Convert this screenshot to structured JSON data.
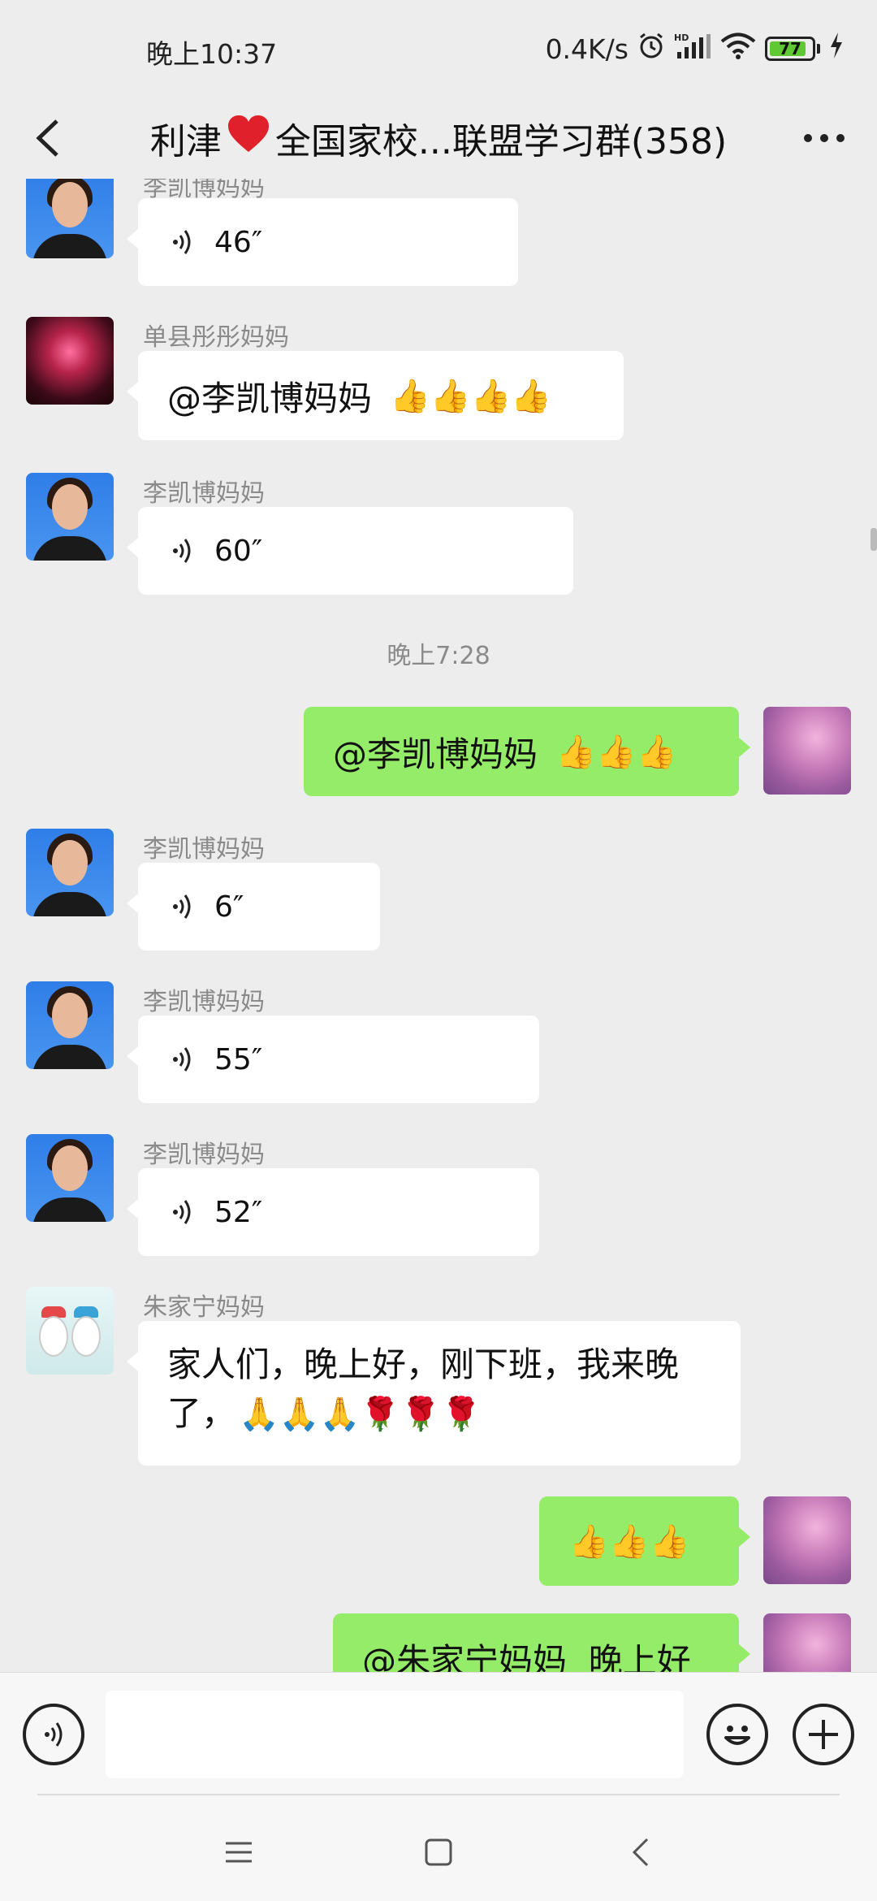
{
  "status_bar": {
    "time": "晚上10:37",
    "network_speed": "0.4K/s",
    "battery": "77"
  },
  "header": {
    "title_prefix": "利津",
    "title_suffix": "全国家校...联盟学习群(358)"
  },
  "messages": [
    {
      "sender": "李凯博妈妈",
      "type": "voice",
      "duration": "46″"
    },
    {
      "sender": "单县彤彤妈妈",
      "type": "text",
      "text": "@李凯博妈妈",
      "emoji": "👍👍👍👍"
    },
    {
      "sender": "李凯博妈妈",
      "type": "voice",
      "duration": "60″"
    },
    {
      "type": "timestamp",
      "text": "晚上7:28"
    },
    {
      "self": true,
      "type": "text",
      "text": "@李凯博妈妈",
      "emoji": "👍👍👍"
    },
    {
      "sender": "李凯博妈妈",
      "type": "voice",
      "duration": "6″"
    },
    {
      "sender": "李凯博妈妈",
      "type": "voice",
      "duration": "55″"
    },
    {
      "sender": "李凯博妈妈",
      "type": "voice",
      "duration": "52″"
    },
    {
      "sender": "朱家宁妈妈",
      "type": "text",
      "line1": "家人们，晚上好，刚下班，我来晚",
      "line2": "了，",
      "emoji": "🙏🙏🙏🌹🌹🌹"
    },
    {
      "self": true,
      "type": "emoji",
      "emoji": "👍👍👍"
    },
    {
      "self": true,
      "type": "text",
      "text": "@朱家宁妈妈  晚上好"
    }
  ],
  "input": {
    "placeholder": ""
  },
  "icons": {
    "back": "back-chevron-icon",
    "more": "more-dots-icon",
    "voice": "voice-input-icon",
    "emoji": "emoji-icon",
    "add": "plus-icon"
  }
}
